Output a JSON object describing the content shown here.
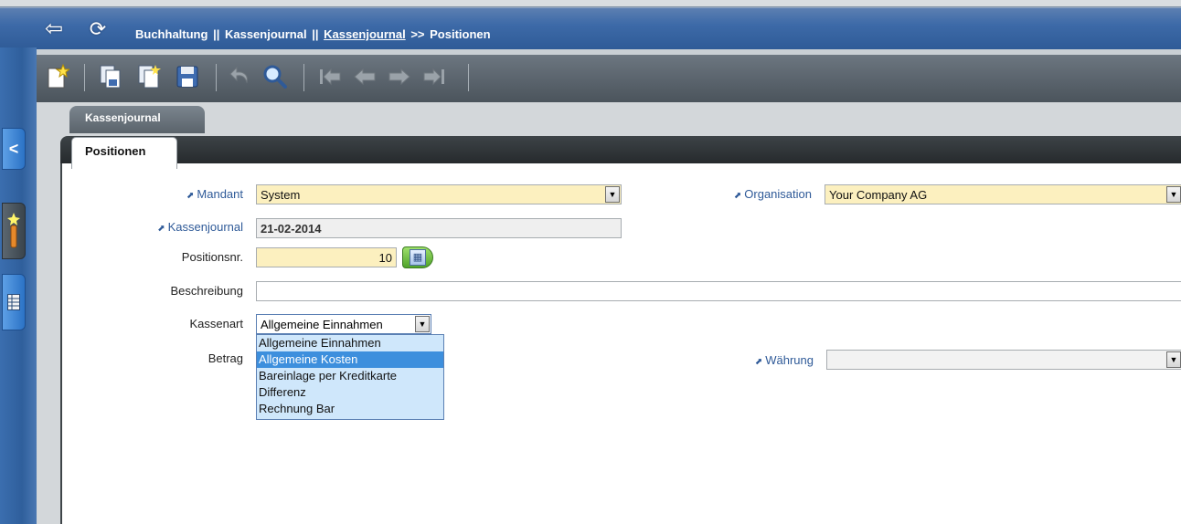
{
  "header": {
    "breadcrumb": {
      "part1": "Buchhaltung",
      "sep1": "||",
      "part2": "Kassenjournal",
      "sep2": "||",
      "link": "Kassenjournal",
      "sep3": ">>",
      "current": "Positionen"
    },
    "back_icon": "arrow-left-icon",
    "refresh_icon": "refresh-icon"
  },
  "toolbar": {
    "icons": [
      "new-record-icon",
      "copy-record-icon",
      "copy-details-icon",
      "save-icon",
      "undo-icon",
      "find-icon",
      "first-record-icon",
      "previous-record-icon",
      "next-record-icon",
      "last-record-icon"
    ]
  },
  "leftrail": {
    "collapse_glyph": "<",
    "icons": [
      "wand-icon",
      "spreadsheet-icon"
    ]
  },
  "tabs": {
    "main": "Kassenjournal",
    "sub": "Positionen"
  },
  "form": {
    "mandant": {
      "label": "Mandant",
      "value": "System"
    },
    "organisation": {
      "label": "Organisation",
      "value": "Your Company AG"
    },
    "kassenjournal": {
      "label": "Kassenjournal",
      "value": "21-02-2014"
    },
    "positionsnr": {
      "label": "Positionsnr.",
      "value": "10"
    },
    "beschreibung": {
      "label": "Beschreibung",
      "value": ""
    },
    "kassenart": {
      "label": "Kassenart",
      "value": "Allgemeine Einnahmen",
      "options": [
        "Allgemeine Einnahmen",
        "Allgemeine Kosten",
        "Bareinlage per Kreditkarte",
        "Differenz",
        "Rechnung Bar"
      ],
      "highlighted": "Allgemeine Kosten"
    },
    "betrag": {
      "label": "Betrag"
    },
    "waehrung": {
      "label": "Währung",
      "value": ""
    }
  },
  "colors": {
    "header_blue": "#3d6aa8",
    "mandatory_bg": "#fcf0bf",
    "link_label": "#2f5a98",
    "dropdown_bg": "#cfe7fb",
    "dropdown_selected": "#3d8fdd"
  }
}
